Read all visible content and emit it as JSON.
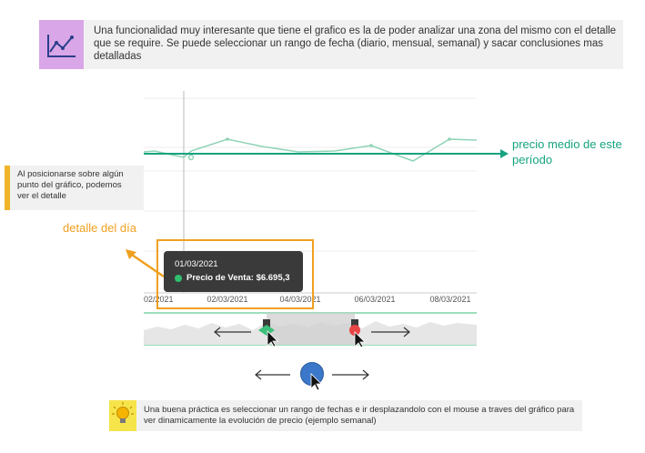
{
  "top_info": {
    "text": "Una funcionalidad muy interesante que tiene el grafico es la de poder analizar una zona del mismo con el detalle que se require. Se puede seleccionar un rango de fecha (diario, mensual, semanal) y sacar conclusiones mas detalladas",
    "icon": "line-chart-icon"
  },
  "side_note": {
    "text": "Al posicionarse sobre algún punto del gráfico, podemos ver el detalle"
  },
  "detail_label": "detalle del día",
  "precio_label": "precio medio de este período",
  "tooltip": {
    "date": "01/03/2021",
    "series": "Precio de Venta:",
    "value": "$6.695,3"
  },
  "x_ticks": [
    "02/2021",
    "02/03/2021",
    "04/03/2021",
    "06/03/2021",
    "08/03/2021"
  ],
  "bottom_info": {
    "text": "Una buena práctica es seleccionar un rango de fechas e ir desplazandolo con el mouse a traves del gráfico para ver dinamicamente la evolución de precio (ejemplo semanal)",
    "icon": "lightbulb-icon"
  },
  "colors": {
    "accent_green": "#16a37f",
    "accent_orange": "#f0a020",
    "icon_bg_purple": "#d9a6e8",
    "side_bar_yellow": "#f0b429",
    "bulb_bg_yellow": "#f6e44b"
  }
}
